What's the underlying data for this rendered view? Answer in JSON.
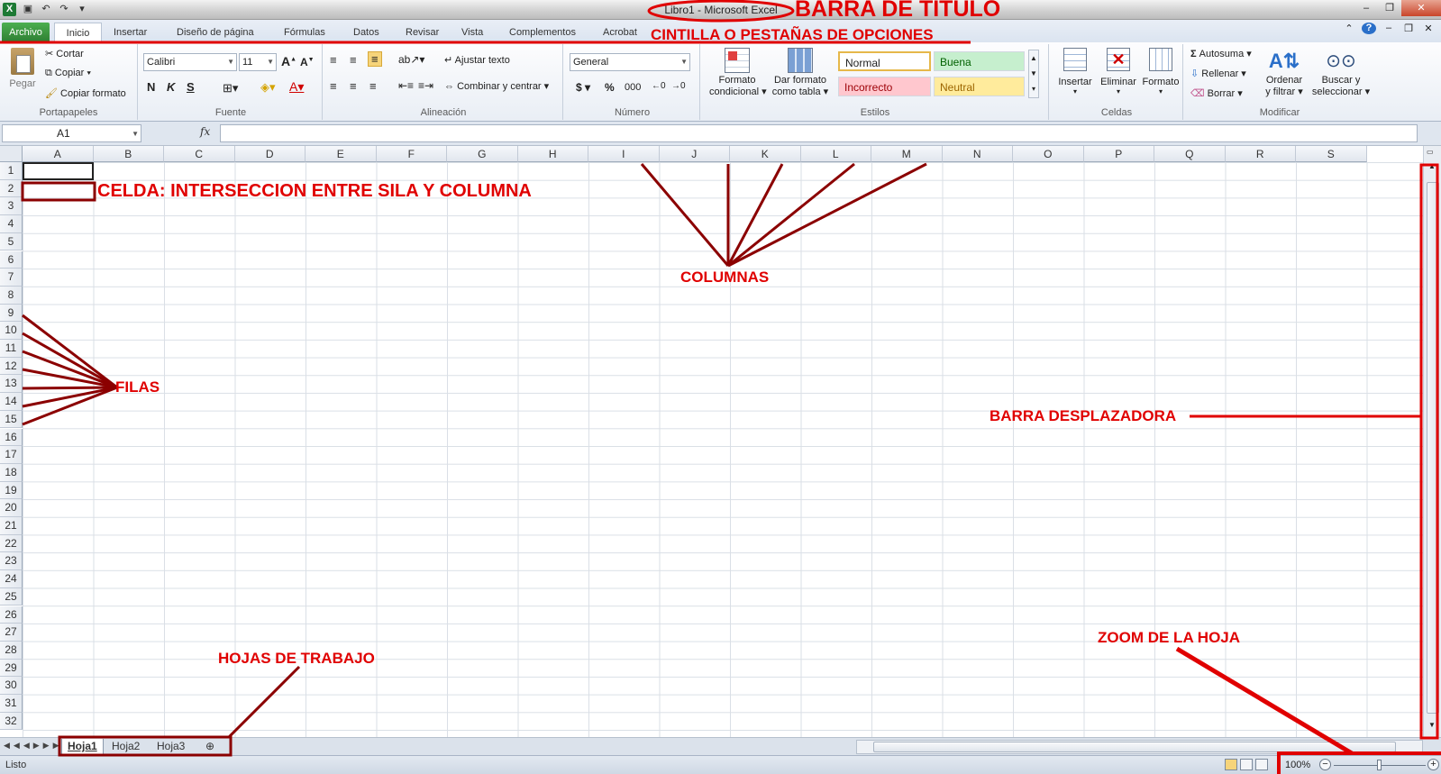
{
  "window": {
    "title": "Libro1  -  Microsoft Excel",
    "app_icon": "X"
  },
  "tabs": {
    "file": "Archivo",
    "home": "Inicio",
    "insert": "Insertar",
    "layout": "Diseño de página",
    "formulas": "Fórmulas",
    "data": "Datos",
    "review": "Revisar",
    "view": "Vista",
    "addins": "Complementos",
    "acrobat": "Acrobat"
  },
  "ribbon": {
    "clipboard": {
      "label": "Portapapeles",
      "paste": "Pegar",
      "cut": "Cortar",
      "copy": "Copiar",
      "format_painter": "Copiar formato"
    },
    "font": {
      "label": "Fuente",
      "font_name": "Calibri",
      "font_size": "11",
      "bold": "N",
      "italic": "K",
      "underline": "S"
    },
    "alignment": {
      "label": "Alineación",
      "wrap": "Ajustar texto",
      "merge": "Combinar y centrar"
    },
    "number": {
      "label": "Número",
      "format": "General",
      "currency": "$",
      "percent": "%",
      "thousands": "000"
    },
    "styles": {
      "label": "Estilos",
      "conditional_1": "Formato",
      "conditional_2": "condicional",
      "table_1": "Dar formato",
      "table_2": "como tabla",
      "normal": "Normal",
      "good": "Buena",
      "bad": "Incorrecto",
      "neutral": "Neutral"
    },
    "cells": {
      "label": "Celdas",
      "insert": "Insertar",
      "delete": "Eliminar",
      "format": "Formato"
    },
    "editing": {
      "label": "Modificar",
      "autosum": "Autosuma",
      "fill": "Rellenar",
      "clear": "Borrar",
      "sort_1": "Ordenar",
      "sort_2": "y filtrar",
      "find_1": "Buscar y",
      "find_2": "seleccionar"
    }
  },
  "formula_bar": {
    "name_box": "A1",
    "fx": "fx",
    "value": ""
  },
  "columns": [
    "A",
    "B",
    "C",
    "D",
    "E",
    "F",
    "G",
    "H",
    "I",
    "J",
    "K",
    "L",
    "M",
    "N",
    "O",
    "P",
    "Q",
    "R",
    "S"
  ],
  "rows": [
    "1",
    "2",
    "3",
    "4",
    "5",
    "6",
    "7",
    "8",
    "9",
    "10",
    "11",
    "12",
    "13",
    "14",
    "15",
    "16",
    "17",
    "18",
    "19",
    "20",
    "21",
    "22",
    "23",
    "24",
    "25",
    "26",
    "27",
    "28",
    "29",
    "30",
    "31",
    "32"
  ],
  "sheets": [
    "Hoja1",
    "Hoja2",
    "Hoja3"
  ],
  "status": {
    "ready": "Listo",
    "zoom": "100%"
  },
  "annotations": {
    "title_bar": "BARRA DE TITULO",
    "tabs": "CINTILLA O PESTAÑAS DE OPCIONES",
    "cell": "CELDA: INTERSECCION ENTRE SILA Y COLUMNA",
    "columns": "COLUMNAS",
    "rows": "FILAS",
    "scrollbar": "BARRA DESPLAZADORA",
    "sheets": "HOJAS DE TRABAJO",
    "zoom": "ZOOM DE LA HOJA"
  },
  "colors": {
    "annotation": "#e00000",
    "annotation_dark": "#8b0000",
    "excel_green": "#2e7d32"
  }
}
